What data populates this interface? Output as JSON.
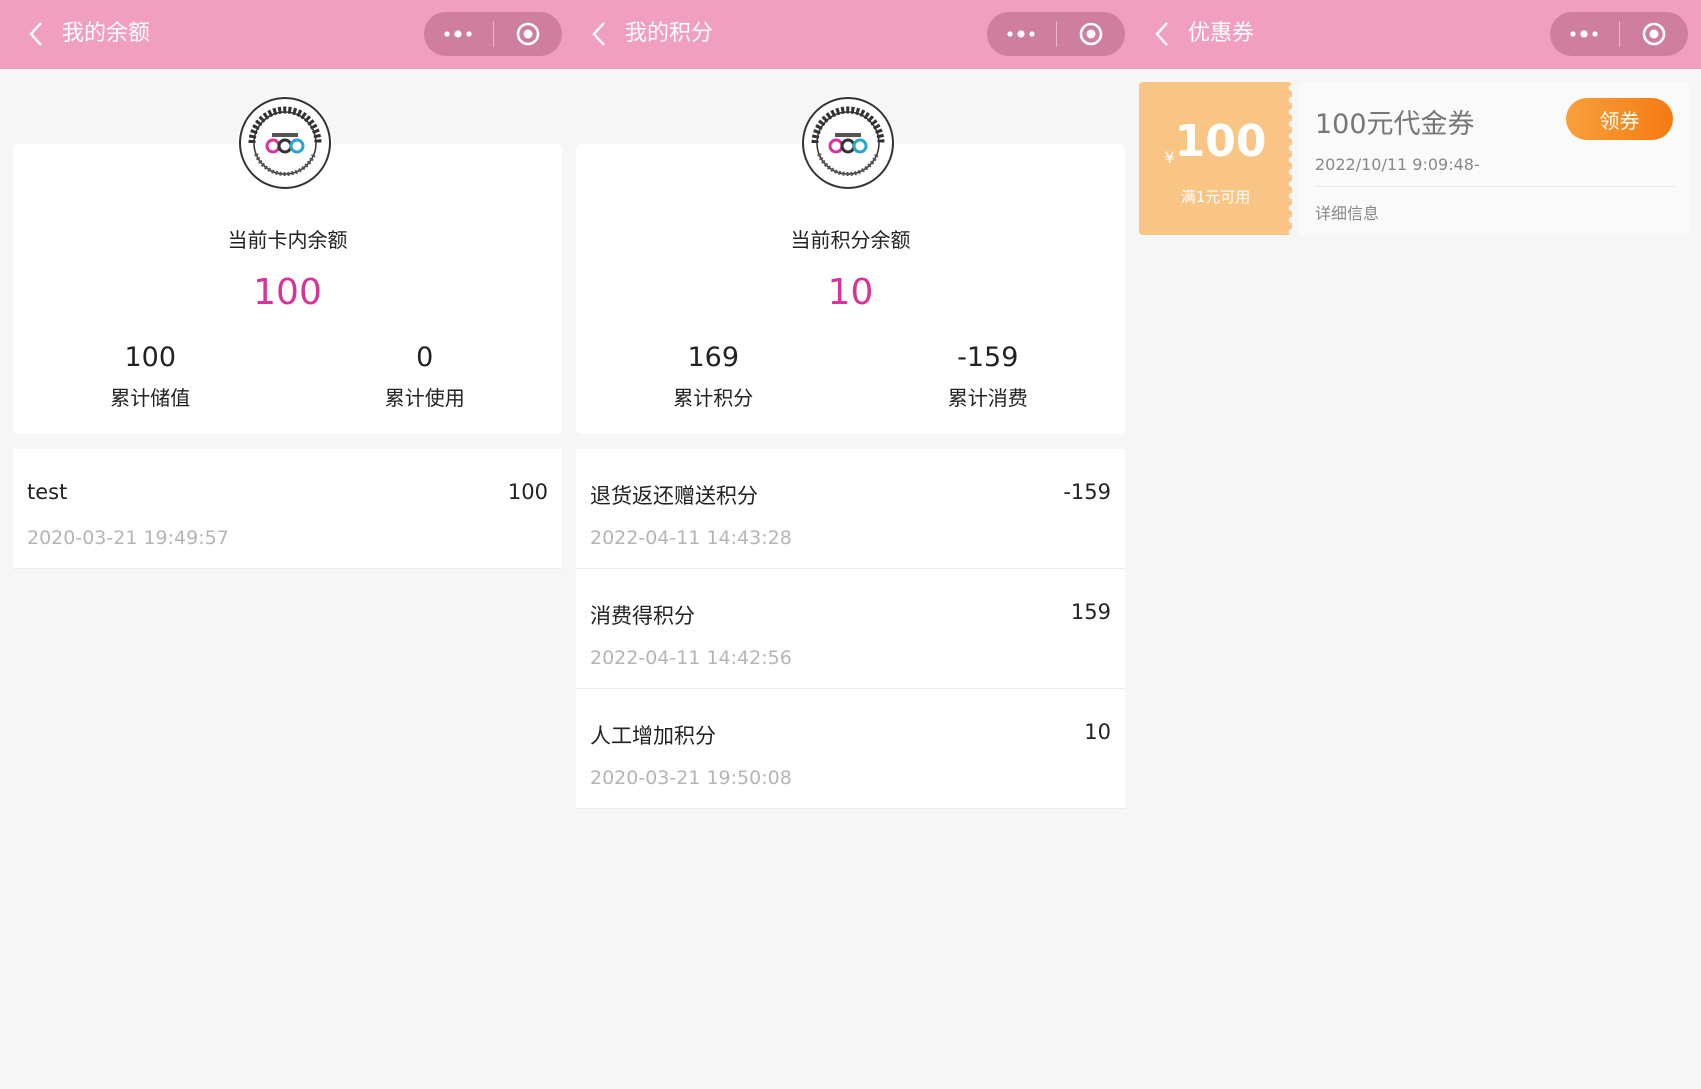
{
  "colors": {
    "navbar": "#f19fbe",
    "accent": "#d6349a",
    "coupon": "#f8c585",
    "button": "#f47a12"
  },
  "icons": {
    "back": "chevron-left-icon",
    "more": "more-dots-icon",
    "close": "target-circle-icon",
    "logo": "sweet-color-logo"
  },
  "screens": [
    {
      "title": "我的余额",
      "summary": {
        "label": "当前卡内余额",
        "value": "100",
        "left": {
          "num": "100",
          "label": "累计储值"
        },
        "right": {
          "num": "0",
          "label": "累计使用"
        }
      },
      "records": [
        {
          "title": "test",
          "amount": "100",
          "time": "2020-03-21 19:49:57"
        }
      ]
    },
    {
      "title": "我的积分",
      "summary": {
        "label": "当前积分余额",
        "value": "10",
        "left": {
          "num": "169",
          "label": "累计积分"
        },
        "right": {
          "num": "-159",
          "label": "累计消费"
        }
      },
      "records": [
        {
          "title": "退货返还赠送积分",
          "amount": "-159",
          "time": "2022-04-11 14:43:28"
        },
        {
          "title": "消费得积分",
          "amount": "159",
          "time": "2022-04-11 14:42:56"
        },
        {
          "title": "人工增加积分",
          "amount": "10",
          "time": "2020-03-21 19:50:08"
        }
      ]
    },
    {
      "title": "优惠券",
      "coupon": {
        "yen": "¥",
        "amount": "100",
        "condition": "满1元可用",
        "name": "100元代金券",
        "date": "2022/10/11 9:09:48-",
        "detail": "详细信息",
        "button": "领券"
      }
    }
  ]
}
